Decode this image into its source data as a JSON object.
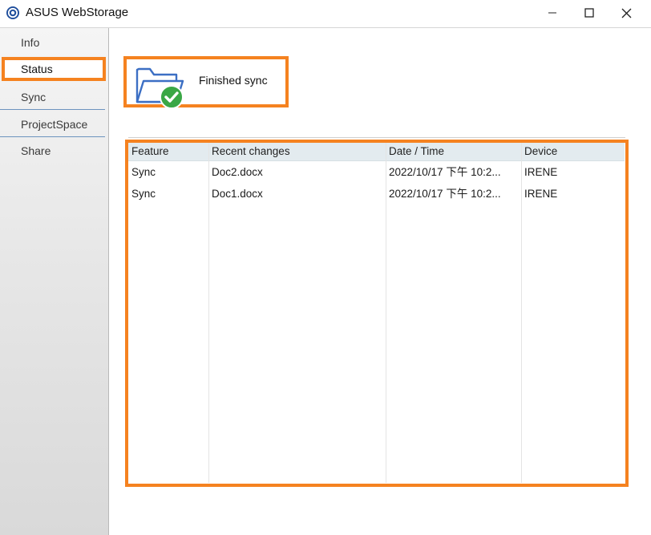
{
  "window": {
    "title": "ASUS WebStorage",
    "icons": {
      "app": "asus-webstorage-logo-icon",
      "minimize": "minimize-icon",
      "maximize": "maximize-icon",
      "close": "close-icon"
    }
  },
  "sidebar": {
    "items": [
      {
        "label": "Info"
      },
      {
        "label": "Status",
        "selected": true
      },
      {
        "label": "Sync"
      },
      {
        "label": "ProjectSpace"
      },
      {
        "label": "Share"
      }
    ]
  },
  "status": {
    "text": "Finished sync",
    "icon": "folder-sync-complete-icon"
  },
  "table": {
    "headers": [
      "Feature",
      "Recent changes",
      "Date / Time",
      "Device"
    ],
    "rows": [
      [
        "Sync",
        "Doc2.docx",
        "2022/10/17 下午 10:2...",
        "IRENE"
      ],
      [
        "Sync",
        "Doc1.docx",
        "2022/10/17 下午 10:2...",
        "IRENE"
      ]
    ]
  },
  "colors": {
    "highlight": "#f58220",
    "header_bg": "#e3ebef",
    "separator": "#6d93be",
    "check_green": "#3aa745",
    "folder_blue": "#3c6fc4"
  }
}
